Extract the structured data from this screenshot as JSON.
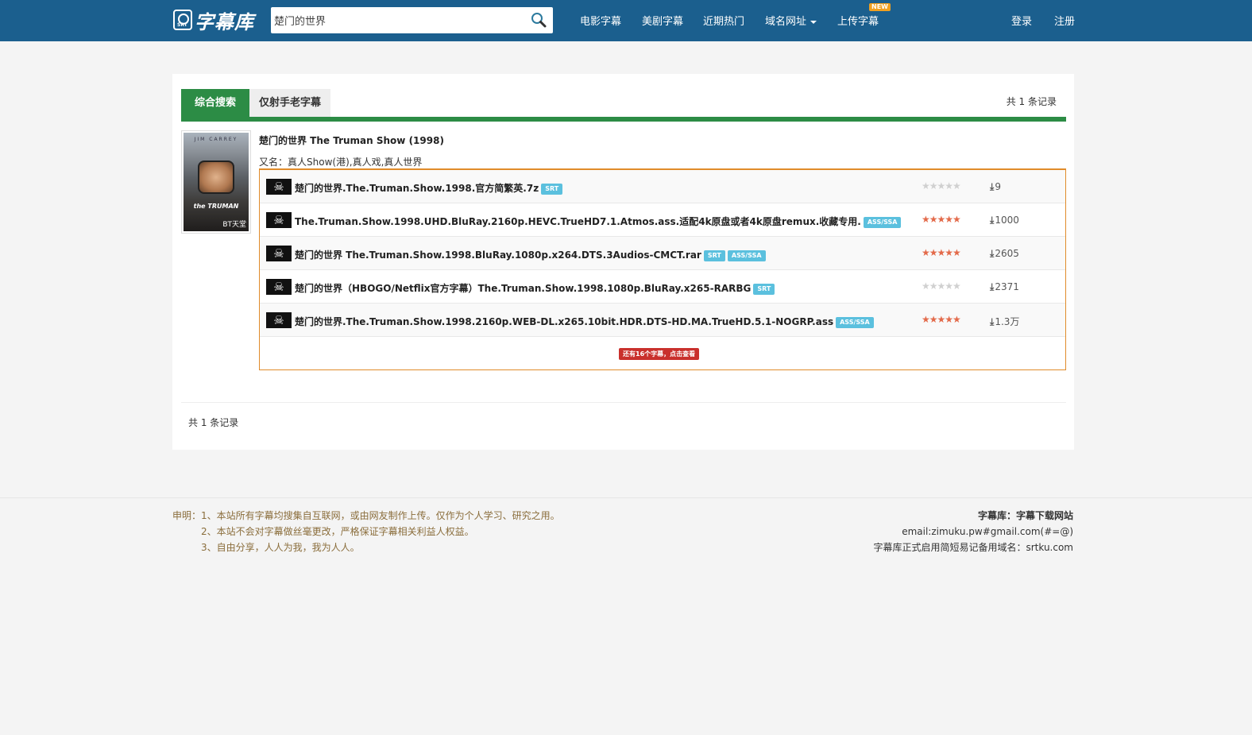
{
  "nav": {
    "logo_text": "字幕库",
    "search_value": "楚门的世界",
    "links": [
      "电影字幕",
      "美剧字幕",
      "近期热门",
      "域名网址",
      "上传字幕"
    ],
    "new_badge": "NEW",
    "login": "登录",
    "register": "注册"
  },
  "tabs": {
    "active": "综合搜索",
    "inactive": "仅射手老字幕"
  },
  "record_count_text": "共 1 条记录",
  "movie": {
    "title": "楚门的世界 The Truman Show (1998)",
    "alias_label": "又名：",
    "alias": "真人Show(港),真人戏,真人世界",
    "poster_top_text": "JIM CARREY",
    "poster_title_text": "the TRUMAN",
    "poster_watermark": "BT天堂"
  },
  "subtitles": [
    {
      "name": "楚门的世界.The.Truman.Show.1998.官方简繁英.7z",
      "formats": [
        "SRT"
      ],
      "rating": 0,
      "downloads": "9"
    },
    {
      "name": "The.Truman.Show.1998.UHD.BluRay.2160p.HEVC.TrueHD7.1.Atmos.ass.适配4k原盘或者4k原盘remux.收藏专用.",
      "formats": [
        "ASS/SSA"
      ],
      "rating": 5,
      "downloads": "1000"
    },
    {
      "name": "楚门的世界 The.Truman.Show.1998.BluRay.1080p.x264.DTS.3Audios-CMCT.rar",
      "formats": [
        "SRT",
        "ASS/SSA"
      ],
      "rating": 5,
      "downloads": "2605"
    },
    {
      "name": "楚门的世界（HBOGO/Netflix官方字幕）The.Truman.Show.1998.1080p.BluRay.x265-RARBG",
      "formats": [
        "SRT"
      ],
      "rating": 0,
      "downloads": "2371"
    },
    {
      "name": "楚门的世界.The.Truman.Show.1998.2160p.WEB-DL.x265.10bit.HDR.DTS-HD.MA.TrueHD.5.1-NOGRP.ass",
      "formats": [
        "ASS/SSA"
      ],
      "rating": 5,
      "downloads": "1.3万"
    }
  ],
  "more_button": "还有16个字幕，点击查看",
  "footer": {
    "declaration": [
      "申明：1、本站所有字幕均搜集自互联网，或由网友制作上传。仅作为个人学习、研究之用。",
      "2、本站不会对字幕做丝毫更改，严格保证字幕相关利益人权益。",
      "3、自由分享，人人为我，我为人人。"
    ],
    "site_name": "字幕库：字幕下载网站",
    "email": "email:zimuku.pw#gmail.com(#=@)",
    "domain_note": "字幕库正式启用简短易记备用域名：srtku.com"
  },
  "colors": {
    "nav_bg": "#1b5f8e",
    "tab_green": "#2c8c45",
    "box_orange": "#e08b2a",
    "star_on": "#e36a4a",
    "badge_blue": "#5bc0de",
    "more_red": "#c9302c"
  }
}
